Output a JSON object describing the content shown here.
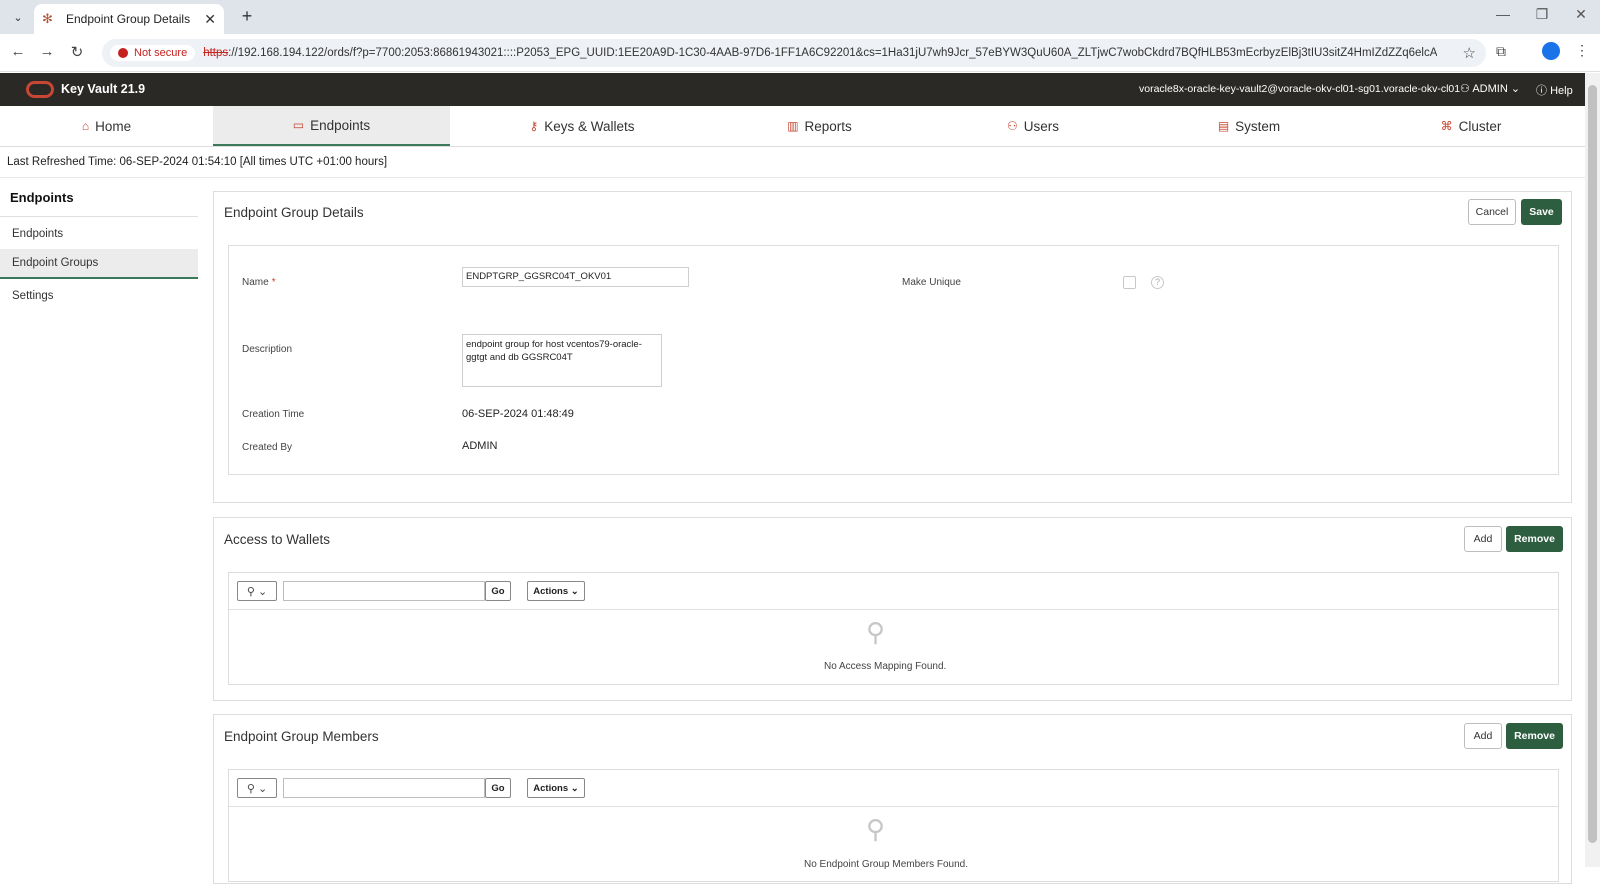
{
  "browser": {
    "tab_title": "Endpoint Group Details",
    "new_tab": "+",
    "security_label": "Not secure",
    "url_scheme": "https",
    "url_rest": "://192.168.194.122/ords/f?p=7700:2053:86861943021::::P2053_EPG_UUID:1EE20A9D-1C30-4AAB-97D6-1FF1A6C92201&cs=1Ha31jU7wh9Jcr_57eBYW3QuU60A_ZLTjwC7wobCkdrd7BQfHLB53mEcrbyzElBj3tIU3sitZ4HmIZdZZq6elcA"
  },
  "header": {
    "product": "Key Vault 21.9",
    "host": "voracle8x-oracle-key-vault2@voracle-okv-cl01-sg01.voracle-okv-cl01",
    "user": "ADMIN",
    "help": "Help"
  },
  "nav": {
    "home": "Home",
    "endpoints": "Endpoints",
    "keys_wallets": "Keys & Wallets",
    "reports": "Reports",
    "users": "Users",
    "system": "System",
    "cluster": "Cluster"
  },
  "refresh_text": "Last Refreshed Time: 06-SEP-2024 01:54:10 [All times UTC +01:00 hours]",
  "sidebar": {
    "title": "Endpoints",
    "items": [
      {
        "label": "Endpoints"
      },
      {
        "label": "Endpoint Groups"
      },
      {
        "label": "Settings"
      }
    ]
  },
  "details": {
    "title": "Endpoint Group Details",
    "cancel": "Cancel",
    "save": "Save",
    "name_label": "Name",
    "name_required": "*",
    "name_value": "ENDPTGRP_GGSRC04T_OKV01",
    "make_unique_label": "Make Unique",
    "description_label": "Description",
    "description_value": "endpoint group for host vcentos79-oracle-ggtgt and db GGSRC04T",
    "creation_time_label": "Creation Time",
    "creation_time_value": "06-SEP-2024 01:48:49",
    "created_by_label": "Created By",
    "created_by_value": "ADMIN"
  },
  "wallets": {
    "title": "Access to Wallets",
    "add": "Add",
    "remove": "Remove",
    "go": "Go",
    "actions": "Actions",
    "empty": "No Access Mapping Found."
  },
  "members": {
    "title": "Endpoint Group Members",
    "add": "Add",
    "remove": "Remove",
    "go": "Go",
    "actions": "Actions",
    "empty": "No Endpoint Group Members Found."
  },
  "colors": {
    "header_bg": "#2b2926",
    "accent_green": "#2e5e40",
    "oracle_red": "#c74634"
  }
}
